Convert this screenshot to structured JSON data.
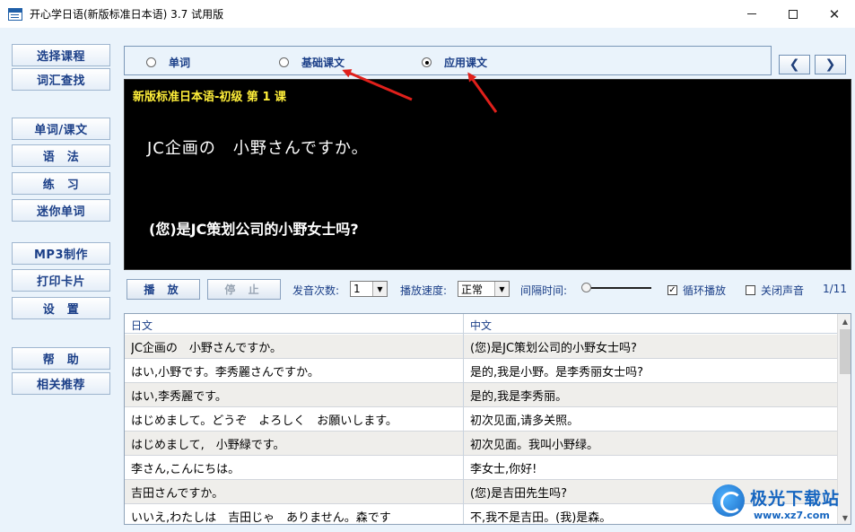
{
  "window": {
    "title": "开心学日语(新版标准日本语) 3.7 试用版"
  },
  "sidebar": {
    "items": [
      {
        "label": "选择课程"
      },
      {
        "label": "词汇查找"
      },
      {
        "label": "单词/课文"
      },
      {
        "label": "语　法"
      },
      {
        "label": "练　习"
      },
      {
        "label": "迷你单词"
      },
      {
        "label": "MP3制作"
      },
      {
        "label": "打印卡片"
      },
      {
        "label": "设　置"
      },
      {
        "label": "帮　助"
      },
      {
        "label": "相关推荐"
      }
    ]
  },
  "mode": {
    "options": [
      {
        "label": "单词",
        "selected": false
      },
      {
        "label": "基础课文",
        "selected": false
      },
      {
        "label": "应用课文",
        "selected": true
      }
    ],
    "prev_icon": "chevron-left-icon",
    "next_icon": "chevron-right-icon"
  },
  "display": {
    "lesson_title": "新版标准日本语-初级 第 1 课",
    "japanese": "JC企画の　小野さんですか。",
    "chinese": "(您)是JC策划公司的小野女士吗?"
  },
  "controls": {
    "play_label": "播 放",
    "stop_label": "停 止",
    "repeat_label": "发音次数:",
    "repeat_value": "1",
    "speed_label": "播放速度:",
    "speed_value": "正常",
    "interval_label": "间隔时间:",
    "interval_level": 0,
    "loop_label": "循环播放",
    "loop_checked": true,
    "mute_label": "关闭声音",
    "mute_checked": false,
    "counter": "1/11"
  },
  "table": {
    "headers": {
      "jp": "日文",
      "cn": "中文"
    },
    "rows": [
      {
        "jp": "JC企画の　小野さんですか。",
        "cn": "(您)是JC策划公司的小野女士吗?"
      },
      {
        "jp": "はい,小野です。李秀麗さんですか。",
        "cn": "是的,我是小野。是李秀丽女士吗?"
      },
      {
        "jp": "はい,李秀麗です。",
        "cn": "是的,我是李秀丽。"
      },
      {
        "jp": "はじめまして。どうぞ　よろしく　お願いします。",
        "cn": "初次见面,请多关照。"
      },
      {
        "jp": "はじめまして,　小野緑です。",
        "cn": "初次见面。我叫小野绿。"
      },
      {
        "jp": "李さん,こんにちは。",
        "cn": "李女士,你好!"
      },
      {
        "jp": "吉田さんですか。",
        "cn": "(您)是吉田先生吗?"
      },
      {
        "jp": "いいえ,わたしは　吉田じゃ　ありません。森です",
        "cn": "不,我不是吉田。(我)是森。"
      }
    ]
  },
  "watermark": {
    "name": "极光下载站",
    "url": "www.xz7.com"
  },
  "colors": {
    "accent": "#1b3f88",
    "lesson_title": "#ffef3a",
    "annotation_arrow": "#e0201b"
  }
}
